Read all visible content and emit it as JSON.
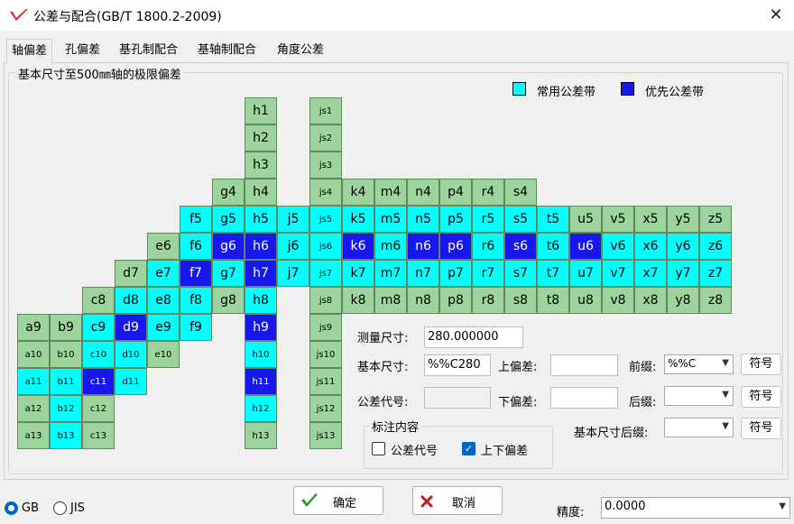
{
  "window": {
    "title": "公差与配合(GB/T 1800.2-2009)",
    "close_label": "✕",
    "logo_icon": "red-check-logo-icon"
  },
  "tabs": [
    "轴偏差",
    "孔偏差",
    "基孔制配合",
    "基轴制配合",
    "角度公差"
  ],
  "active_tab": 0,
  "group_title": "基本尺寸至500㎜轴的极限偏差",
  "legend": {
    "common_label": "常用公差带",
    "common_color": "#00ffff",
    "preferred_label": "优先公差带",
    "preferred_color": "#1818ee",
    "other_color": "#9dd49d"
  },
  "cells": [
    {
      "l": "h1",
      "t": "g"
    },
    {
      "l": "js1",
      "t": "g"
    },
    {
      "l": "h2",
      "t": "g"
    },
    {
      "l": "js2",
      "t": "g"
    },
    {
      "l": "h3",
      "t": "g"
    },
    {
      "l": "js3",
      "t": "g"
    },
    {
      "l": "g4",
      "t": "g"
    },
    {
      "l": "h4",
      "t": "g"
    },
    {
      "l": "js4",
      "t": "g"
    },
    {
      "l": "k4",
      "t": "g"
    },
    {
      "l": "m4",
      "t": "g"
    },
    {
      "l": "n4",
      "t": "g"
    },
    {
      "l": "p4",
      "t": "g"
    },
    {
      "l": "r4",
      "t": "g"
    },
    {
      "l": "s4",
      "t": "g"
    },
    {
      "l": "f5",
      "t": "c"
    },
    {
      "l": "g5",
      "t": "c"
    },
    {
      "l": "h5",
      "t": "c"
    },
    {
      "l": "j5",
      "t": "c"
    },
    {
      "l": "js5",
      "t": "c"
    },
    {
      "l": "k5",
      "t": "c"
    },
    {
      "l": "m5",
      "t": "c"
    },
    {
      "l": "n5",
      "t": "c"
    },
    {
      "l": "p5",
      "t": "c"
    },
    {
      "l": "r5",
      "t": "c"
    },
    {
      "l": "s5",
      "t": "c"
    },
    {
      "l": "t5",
      "t": "c"
    },
    {
      "l": "u5",
      "t": "g"
    },
    {
      "l": "v5",
      "t": "g"
    },
    {
      "l": "x5",
      "t": "g"
    },
    {
      "l": "y5",
      "t": "g"
    },
    {
      "l": "z5",
      "t": "g"
    },
    {
      "l": "e6",
      "t": "g"
    },
    {
      "l": "f6",
      "t": "c"
    },
    {
      "l": "g6",
      "t": "p"
    },
    {
      "l": "h6",
      "t": "p"
    },
    {
      "l": "j6",
      "t": "c"
    },
    {
      "l": "js6",
      "t": "c"
    },
    {
      "l": "k6",
      "t": "p"
    },
    {
      "l": "m6",
      "t": "c"
    },
    {
      "l": "n6",
      "t": "p"
    },
    {
      "l": "p6",
      "t": "p"
    },
    {
      "l": "r6",
      "t": "c"
    },
    {
      "l": "s6",
      "t": "p"
    },
    {
      "l": "t6",
      "t": "c"
    },
    {
      "l": "u6",
      "t": "p"
    },
    {
      "l": "v6",
      "t": "c"
    },
    {
      "l": "x6",
      "t": "c"
    },
    {
      "l": "y6",
      "t": "c"
    },
    {
      "l": "z6",
      "t": "c"
    },
    {
      "l": "d7",
      "t": "g"
    },
    {
      "l": "e7",
      "t": "c"
    },
    {
      "l": "f7",
      "t": "p"
    },
    {
      "l": "g7",
      "t": "c"
    },
    {
      "l": "h7",
      "t": "p"
    },
    {
      "l": "j7",
      "t": "c"
    },
    {
      "l": "js7",
      "t": "c"
    },
    {
      "l": "k7",
      "t": "c"
    },
    {
      "l": "m7",
      "t": "c"
    },
    {
      "l": "n7",
      "t": "c"
    },
    {
      "l": "p7",
      "t": "c"
    },
    {
      "l": "r7",
      "t": "c"
    },
    {
      "l": "s7",
      "t": "c"
    },
    {
      "l": "t7",
      "t": "c"
    },
    {
      "l": "u7",
      "t": "c"
    },
    {
      "l": "v7",
      "t": "c"
    },
    {
      "l": "x7",
      "t": "c"
    },
    {
      "l": "y7",
      "t": "c"
    },
    {
      "l": "z7",
      "t": "c"
    },
    {
      "l": "c8",
      "t": "g"
    },
    {
      "l": "d8",
      "t": "c"
    },
    {
      "l": "e8",
      "t": "c"
    },
    {
      "l": "f8",
      "t": "c"
    },
    {
      "l": "g8",
      "t": "g"
    },
    {
      "l": "h8",
      "t": "c"
    },
    {
      "l": "js8",
      "t": "g"
    },
    {
      "l": "k8",
      "t": "g"
    },
    {
      "l": "m8",
      "t": "g"
    },
    {
      "l": "n8",
      "t": "g"
    },
    {
      "l": "p8",
      "t": "g"
    },
    {
      "l": "r8",
      "t": "g"
    },
    {
      "l": "s8",
      "t": "g"
    },
    {
      "l": "t8",
      "t": "g"
    },
    {
      "l": "u8",
      "t": "g"
    },
    {
      "l": "v8",
      "t": "g"
    },
    {
      "l": "x8",
      "t": "g"
    },
    {
      "l": "y8",
      "t": "g"
    },
    {
      "l": "z8",
      "t": "g"
    },
    {
      "l": "a9",
      "t": "g"
    },
    {
      "l": "b9",
      "t": "g"
    },
    {
      "l": "c9",
      "t": "c"
    },
    {
      "l": "d9",
      "t": "p"
    },
    {
      "l": "e9",
      "t": "c"
    },
    {
      "l": "f9",
      "t": "c"
    },
    {
      "l": "h9",
      "t": "p"
    },
    {
      "l": "js9",
      "t": "g"
    },
    {
      "l": "a10",
      "t": "g"
    },
    {
      "l": "b10",
      "t": "g"
    },
    {
      "l": "c10",
      "t": "c"
    },
    {
      "l": "d10",
      "t": "c"
    },
    {
      "l": "e10",
      "t": "g"
    },
    {
      "l": "h10",
      "t": "c"
    },
    {
      "l": "js10",
      "t": "g"
    },
    {
      "l": "a11",
      "t": "c"
    },
    {
      "l": "b11",
      "t": "c"
    },
    {
      "l": "c11",
      "t": "p"
    },
    {
      "l": "d11",
      "t": "c"
    },
    {
      "l": "h11",
      "t": "p"
    },
    {
      "l": "js11",
      "t": "g"
    },
    {
      "l": "a12",
      "t": "g"
    },
    {
      "l": "b12",
      "t": "c"
    },
    {
      "l": "c12",
      "t": "g"
    },
    {
      "l": "h12",
      "t": "c"
    },
    {
      "l": "js12",
      "t": "g"
    },
    {
      "l": "a13",
      "t": "g"
    },
    {
      "l": "b13",
      "t": "c"
    },
    {
      "l": "c13",
      "t": "g"
    },
    {
      "l": "h13",
      "t": "g"
    },
    {
      "l": "js13",
      "t": "g"
    }
  ],
  "form": {
    "measure_label": "测量尺寸:",
    "measure_value": "280.000000",
    "basic_label": "基本尺寸:",
    "basic_value": "%%C280",
    "upper_label": "上偏差:",
    "upper_value": "",
    "prefix_label": "前缀:",
    "prefix_value": "%%C",
    "symbol_label": "符号",
    "code_label": "公差代号:",
    "code_value": "",
    "lower_label": "下偏差:",
    "lower_value": "",
    "suffix_label": "后缀:",
    "suffix_value": "",
    "basic_suffix_label": "基本尺寸后缀:",
    "basic_suffix_value": ""
  },
  "annotation": {
    "title": "标注内容",
    "code_label": "公差代号",
    "code_checked": false,
    "dev_label": "上下偏差",
    "dev_checked": true
  },
  "footer": {
    "gb_label": "GB",
    "jis_label": "JIS",
    "standard": "GB",
    "ok_label": "确定",
    "ok_icon": "green-check-icon",
    "cancel_label": "取消",
    "cancel_icon": "red-x-icon",
    "precision_label": "精度:",
    "precision_value": "0.0000"
  }
}
